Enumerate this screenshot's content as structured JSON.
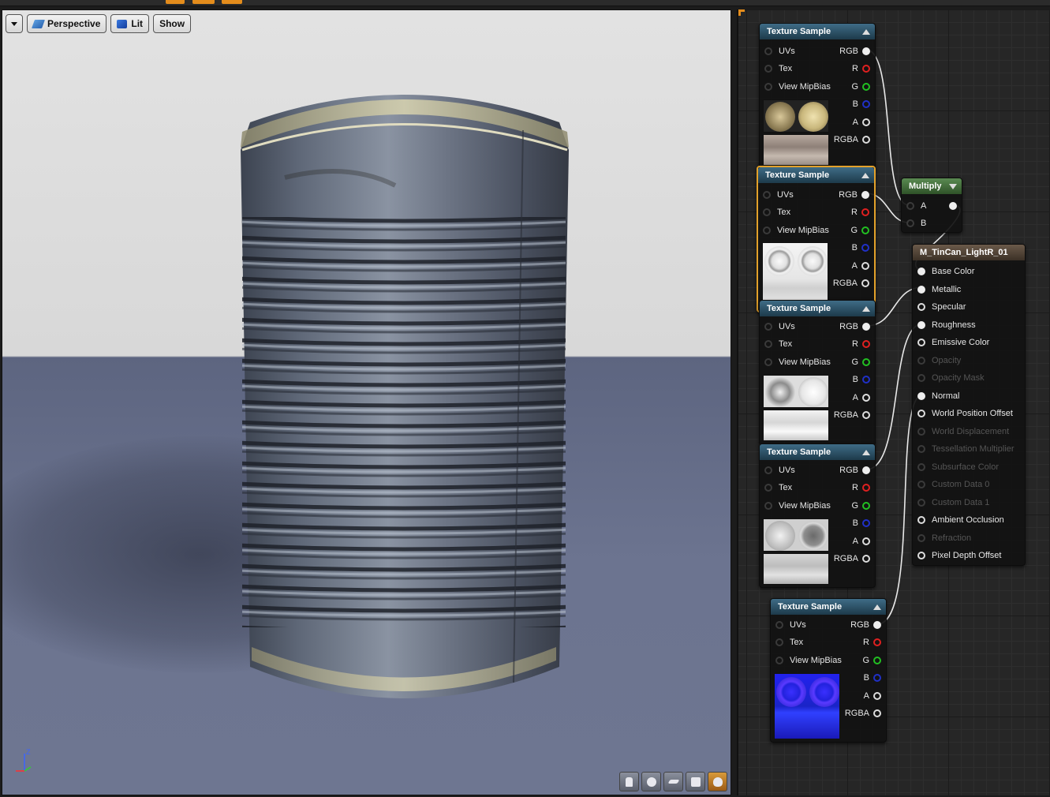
{
  "viewport": {
    "view_mode": "Perspective",
    "lighting_mode": "Lit",
    "show_label": "Show"
  },
  "graph": {
    "texture_nodes": [
      {
        "title": "Texture Sample",
        "inputs": [
          "UVs",
          "Tex",
          "View MipBias"
        ],
        "outputs": [
          "RGB",
          "R",
          "G",
          "B",
          "A",
          "RGBA"
        ],
        "preview": "rust-metal"
      },
      {
        "title": "Texture Sample",
        "inputs": [
          "UVs",
          "Tex",
          "View MipBias"
        ],
        "outputs": [
          "RGB",
          "R",
          "G",
          "B",
          "A",
          "RGBA"
        ],
        "preview": "metallic-mask"
      },
      {
        "title": "Texture Sample",
        "inputs": [
          "UVs",
          "Tex",
          "View MipBias"
        ],
        "outputs": [
          "RGB",
          "R",
          "G",
          "B",
          "A",
          "RGBA"
        ],
        "preview": "roughness-map"
      },
      {
        "title": "Texture Sample",
        "inputs": [
          "UVs",
          "Tex",
          "View MipBias"
        ],
        "outputs": [
          "RGB",
          "R",
          "G",
          "B",
          "A",
          "RGBA"
        ],
        "preview": "gray-map"
      },
      {
        "title": "Texture Sample",
        "inputs": [
          "UVs",
          "Tex",
          "View MipBias"
        ],
        "outputs": [
          "RGB",
          "R",
          "G",
          "B",
          "A",
          "RGBA"
        ],
        "preview": "normal-map"
      }
    ],
    "multiply": {
      "title": "Multiply",
      "inputs": [
        "A",
        "B"
      ]
    },
    "material": {
      "title": "M_TinCan_LightR_01",
      "inputs": [
        {
          "label": "Base Color",
          "enabled": true
        },
        {
          "label": "Metallic",
          "enabled": true
        },
        {
          "label": "Specular",
          "enabled": true
        },
        {
          "label": "Roughness",
          "enabled": true
        },
        {
          "label": "Emissive Color",
          "enabled": true
        },
        {
          "label": "Opacity",
          "enabled": false
        },
        {
          "label": "Opacity Mask",
          "enabled": false
        },
        {
          "label": "Normal",
          "enabled": true
        },
        {
          "label": "World Position Offset",
          "enabled": true
        },
        {
          "label": "World Displacement",
          "enabled": false
        },
        {
          "label": "Tessellation Multiplier",
          "enabled": false
        },
        {
          "label": "Subsurface Color",
          "enabled": false
        },
        {
          "label": "Custom Data 0",
          "enabled": false
        },
        {
          "label": "Custom Data 1",
          "enabled": false
        },
        {
          "label": "Ambient Occlusion",
          "enabled": true
        },
        {
          "label": "Refraction",
          "enabled": false
        },
        {
          "label": "Pixel Depth Offset",
          "enabled": true
        }
      ]
    }
  },
  "colors": {
    "accent": "#e38c1c",
    "selection": "#e3a12a",
    "texture_header": "#3f6c86",
    "multiply_header": "#5a8a52"
  }
}
